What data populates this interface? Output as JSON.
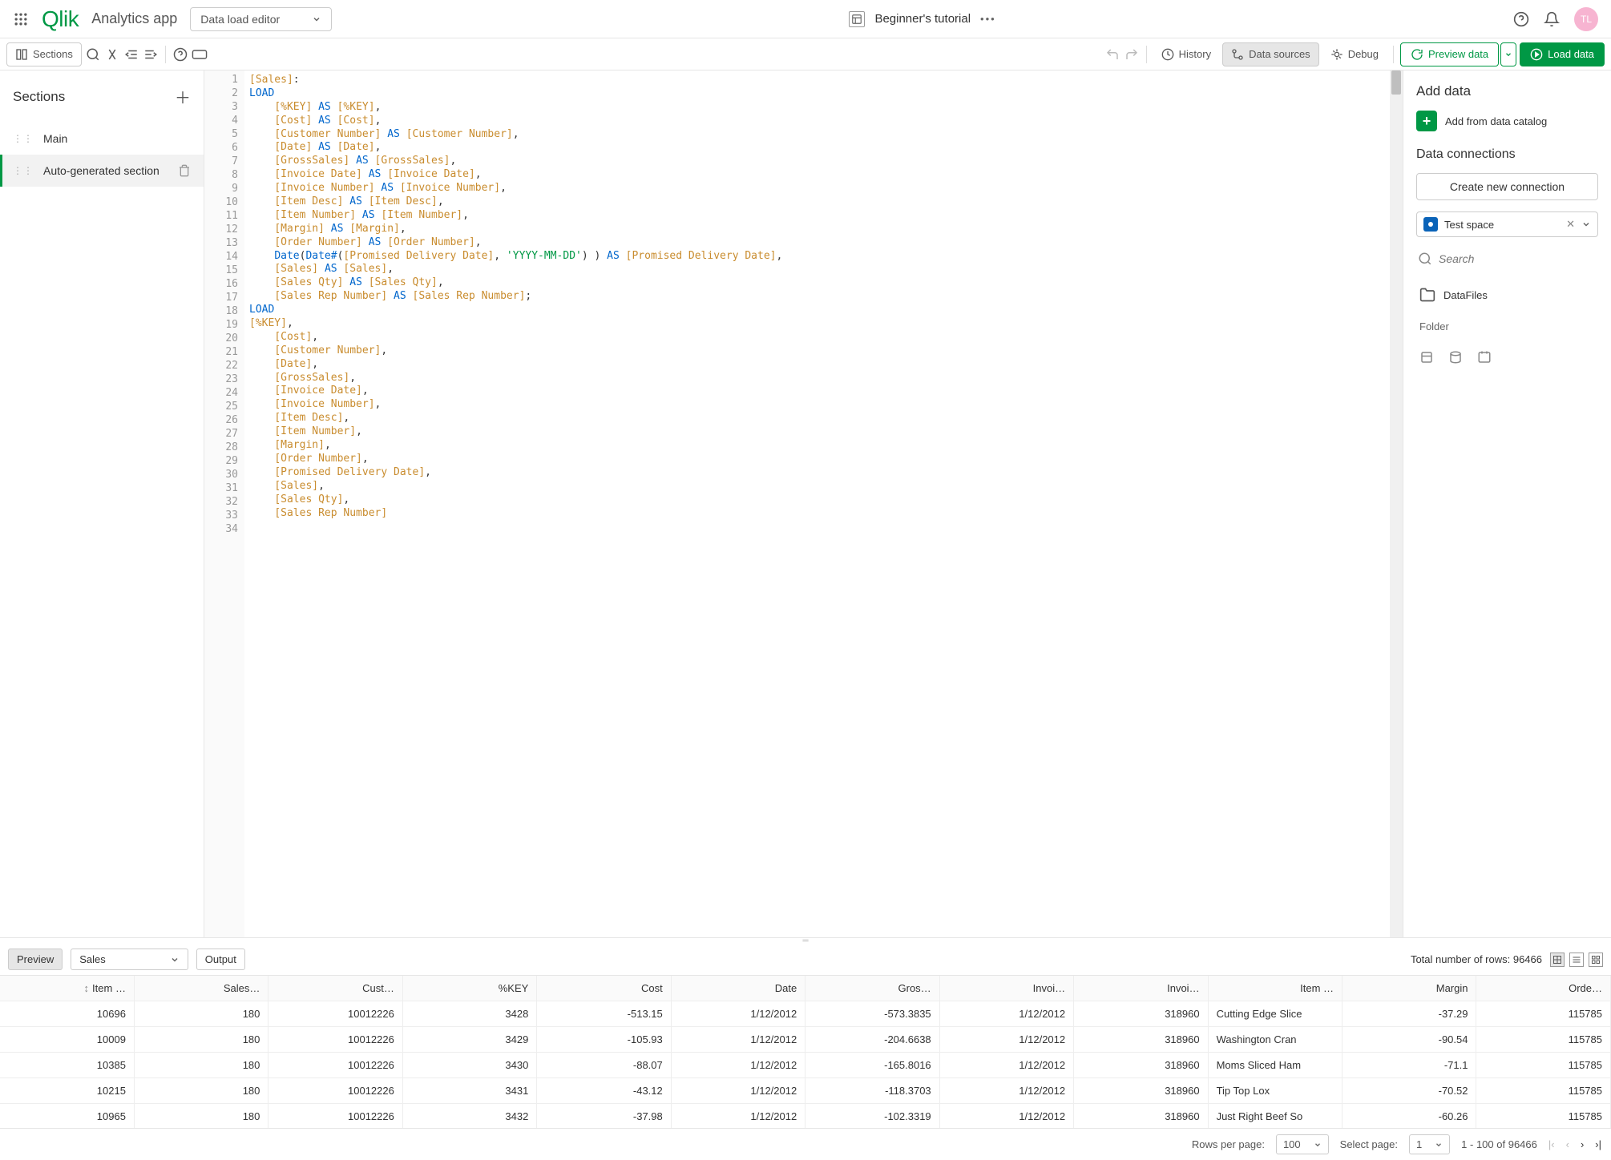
{
  "topbar": {
    "logo": "Qlik",
    "appName": "Analytics app",
    "mode": "Data load editor",
    "tutorial": "Beginner's tutorial",
    "avatar": "TL"
  },
  "toolbar": {
    "sections": "Sections",
    "history": "History",
    "dataSources": "Data sources",
    "debug": "Debug",
    "preview": "Preview data",
    "load": "Load data"
  },
  "sections": {
    "title": "Sections",
    "items": [
      {
        "label": "Main",
        "active": false
      },
      {
        "label": "Auto-generated section",
        "active": true
      }
    ]
  },
  "rightPanel": {
    "addData": "Add data",
    "addCatalog": "Add from data catalog",
    "dataConnections": "Data connections",
    "createConn": "Create new connection",
    "space": "Test space",
    "searchPlaceholder": "Search",
    "dataFiles": "DataFiles",
    "folder": "Folder"
  },
  "code": {
    "lines": [
      [
        {
          "t": "[Sales]",
          "c": "br"
        },
        {
          "t": ":"
        }
      ],
      [
        {
          "t": "LOAD",
          "c": "kw"
        }
      ],
      [
        {
          "t": "    "
        },
        {
          "t": "[%KEY]",
          "c": "br"
        },
        {
          "t": " "
        },
        {
          "t": "AS",
          "c": "kw"
        },
        {
          "t": " "
        },
        {
          "t": "[%KEY]",
          "c": "br"
        },
        {
          "t": ","
        }
      ],
      [
        {
          "t": "    "
        },
        {
          "t": "[Cost]",
          "c": "br"
        },
        {
          "t": " "
        },
        {
          "t": "AS",
          "c": "kw"
        },
        {
          "t": " "
        },
        {
          "t": "[Cost]",
          "c": "br"
        },
        {
          "t": ","
        }
      ],
      [
        {
          "t": "    "
        },
        {
          "t": "[Customer Number]",
          "c": "br"
        },
        {
          "t": " "
        },
        {
          "t": "AS",
          "c": "kw"
        },
        {
          "t": " "
        },
        {
          "t": "[Customer Number]",
          "c": "br"
        },
        {
          "t": ","
        }
      ],
      [
        {
          "t": "    "
        },
        {
          "t": "[Date]",
          "c": "br"
        },
        {
          "t": " "
        },
        {
          "t": "AS",
          "c": "kw"
        },
        {
          "t": " "
        },
        {
          "t": "[Date]",
          "c": "br"
        },
        {
          "t": ","
        }
      ],
      [
        {
          "t": "    "
        },
        {
          "t": "[GrossSales]",
          "c": "br"
        },
        {
          "t": " "
        },
        {
          "t": "AS",
          "c": "kw"
        },
        {
          "t": " "
        },
        {
          "t": "[GrossSales]",
          "c": "br"
        },
        {
          "t": ","
        }
      ],
      [
        {
          "t": "    "
        },
        {
          "t": "[Invoice Date]",
          "c": "br"
        },
        {
          "t": " "
        },
        {
          "t": "AS",
          "c": "kw"
        },
        {
          "t": " "
        },
        {
          "t": "[Invoice Date]",
          "c": "br"
        },
        {
          "t": ","
        }
      ],
      [
        {
          "t": "    "
        },
        {
          "t": "[Invoice Number]",
          "c": "br"
        },
        {
          "t": " "
        },
        {
          "t": "AS",
          "c": "kw"
        },
        {
          "t": " "
        },
        {
          "t": "[Invoice Number]",
          "c": "br"
        },
        {
          "t": ","
        }
      ],
      [
        {
          "t": "    "
        },
        {
          "t": "[Item Desc]",
          "c": "br"
        },
        {
          "t": " "
        },
        {
          "t": "AS",
          "c": "kw"
        },
        {
          "t": " "
        },
        {
          "t": "[Item Desc]",
          "c": "br"
        },
        {
          "t": ","
        }
      ],
      [
        {
          "t": "    "
        },
        {
          "t": "[Item Number]",
          "c": "br"
        },
        {
          "t": " "
        },
        {
          "t": "AS",
          "c": "kw"
        },
        {
          "t": " "
        },
        {
          "t": "[Item Number]",
          "c": "br"
        },
        {
          "t": ","
        }
      ],
      [
        {
          "t": "    "
        },
        {
          "t": "[Margin]",
          "c": "br"
        },
        {
          "t": " "
        },
        {
          "t": "AS",
          "c": "kw"
        },
        {
          "t": " "
        },
        {
          "t": "[Margin]",
          "c": "br"
        },
        {
          "t": ","
        }
      ],
      [
        {
          "t": "    "
        },
        {
          "t": "[Order Number]",
          "c": "br"
        },
        {
          "t": " "
        },
        {
          "t": "AS",
          "c": "kw"
        },
        {
          "t": " "
        },
        {
          "t": "[Order Number]",
          "c": "br"
        },
        {
          "t": ","
        }
      ],
      [
        {
          "t": "    "
        },
        {
          "t": "Date",
          "c": "fn"
        },
        {
          "t": "("
        },
        {
          "t": "Date#",
          "c": "fn"
        },
        {
          "t": "("
        },
        {
          "t": "[Promised Delivery Date]",
          "c": "br"
        },
        {
          "t": ", "
        },
        {
          "t": "'YYYY-MM-DD'",
          "c": "str"
        },
        {
          "t": ") ) "
        },
        {
          "t": "AS",
          "c": "kw"
        },
        {
          "t": " "
        },
        {
          "t": "[Promised Delivery Date]",
          "c": "br"
        },
        {
          "t": ","
        }
      ],
      [
        {
          "t": "    "
        },
        {
          "t": "[Sales]",
          "c": "br"
        },
        {
          "t": " "
        },
        {
          "t": "AS",
          "c": "kw"
        },
        {
          "t": " "
        },
        {
          "t": "[Sales]",
          "c": "br"
        },
        {
          "t": ","
        }
      ],
      [
        {
          "t": "    "
        },
        {
          "t": "[Sales Qty]",
          "c": "br"
        },
        {
          "t": " "
        },
        {
          "t": "AS",
          "c": "kw"
        },
        {
          "t": " "
        },
        {
          "t": "[Sales Qty]",
          "c": "br"
        },
        {
          "t": ","
        }
      ],
      [
        {
          "t": "    "
        },
        {
          "t": "[Sales Rep Number]",
          "c": "br"
        },
        {
          "t": " "
        },
        {
          "t": "AS",
          "c": "kw"
        },
        {
          "t": " "
        },
        {
          "t": "[Sales Rep Number]",
          "c": "br"
        },
        {
          "t": ";"
        }
      ],
      [
        {
          "t": "LOAD",
          "c": "kw"
        }
      ],
      [
        {
          "t": "[%KEY]",
          "c": "br"
        },
        {
          "t": ","
        }
      ],
      [
        {
          "t": "    "
        },
        {
          "t": "[Cost]",
          "c": "br"
        },
        {
          "t": ","
        }
      ],
      [
        {
          "t": "    "
        },
        {
          "t": "[Customer Number]",
          "c": "br"
        },
        {
          "t": ","
        }
      ],
      [
        {
          "t": "    "
        },
        {
          "t": "[Date]",
          "c": "br"
        },
        {
          "t": ","
        }
      ],
      [
        {
          "t": "    "
        },
        {
          "t": "[GrossSales]",
          "c": "br"
        },
        {
          "t": ","
        }
      ],
      [
        {
          "t": "    "
        },
        {
          "t": "[Invoice Date]",
          "c": "br"
        },
        {
          "t": ","
        }
      ],
      [
        {
          "t": "    "
        },
        {
          "t": "[Invoice Number]",
          "c": "br"
        },
        {
          "t": ","
        }
      ],
      [
        {
          "t": "    "
        },
        {
          "t": "[Item Desc]",
          "c": "br"
        },
        {
          "t": ","
        }
      ],
      [
        {
          "t": "    "
        },
        {
          "t": "[Item Number]",
          "c": "br"
        },
        {
          "t": ","
        }
      ],
      [
        {
          "t": "    "
        },
        {
          "t": "[Margin]",
          "c": "br"
        },
        {
          "t": ","
        }
      ],
      [
        {
          "t": "    "
        },
        {
          "t": "[Order Number]",
          "c": "br"
        },
        {
          "t": ","
        }
      ],
      [
        {
          "t": "    "
        },
        {
          "t": "[Promised Delivery Date]",
          "c": "br"
        },
        {
          "t": ","
        }
      ],
      [
        {
          "t": "    "
        },
        {
          "t": "[Sales]",
          "c": "br"
        },
        {
          "t": ","
        }
      ],
      [
        {
          "t": "    "
        },
        {
          "t": "[Sales Qty]",
          "c": "br"
        },
        {
          "t": ","
        }
      ],
      [
        {
          "t": "    "
        },
        {
          "t": "[Sales Rep Number]",
          "c": "br"
        }
      ],
      [
        {
          "t": " "
        }
      ]
    ]
  },
  "preview": {
    "tab": "Preview",
    "selected": "Sales",
    "output": "Output",
    "totalLabel": "Total number of rows: 96466",
    "columns": [
      "Item …",
      "Sales…",
      "Cust…",
      "%KEY",
      "Cost",
      "Date",
      "Gros…",
      "Invoi…",
      "Invoi…",
      "Item …",
      "Margin",
      "Orde…"
    ],
    "rows": [
      [
        "10696",
        "180",
        "10012226",
        "3428",
        "-513.15",
        "1/12/2012",
        "-573.3835",
        "1/12/2012",
        "318960",
        "Cutting Edge Slice",
        "-37.29",
        "115785"
      ],
      [
        "10009",
        "180",
        "10012226",
        "3429",
        "-105.93",
        "1/12/2012",
        "-204.6638",
        "1/12/2012",
        "318960",
        "Washington Cran",
        "-90.54",
        "115785"
      ],
      [
        "10385",
        "180",
        "10012226",
        "3430",
        "-88.07",
        "1/12/2012",
        "-165.8016",
        "1/12/2012",
        "318960",
        "Moms Sliced Ham",
        "-71.1",
        "115785"
      ],
      [
        "10215",
        "180",
        "10012226",
        "3431",
        "-43.12",
        "1/12/2012",
        "-118.3703",
        "1/12/2012",
        "318960",
        "Tip Top Lox",
        "-70.52",
        "115785"
      ],
      [
        "10965",
        "180",
        "10012226",
        "3432",
        "-37.98",
        "1/12/2012",
        "-102.3319",
        "1/12/2012",
        "318960",
        "Just Right Beef So",
        "-60.26",
        "115785"
      ]
    ]
  },
  "pager": {
    "rowsLabel": "Rows per page:",
    "rows": "100",
    "pageLabel": "Select page:",
    "page": "1",
    "range": "1 - 100 of 96466"
  }
}
